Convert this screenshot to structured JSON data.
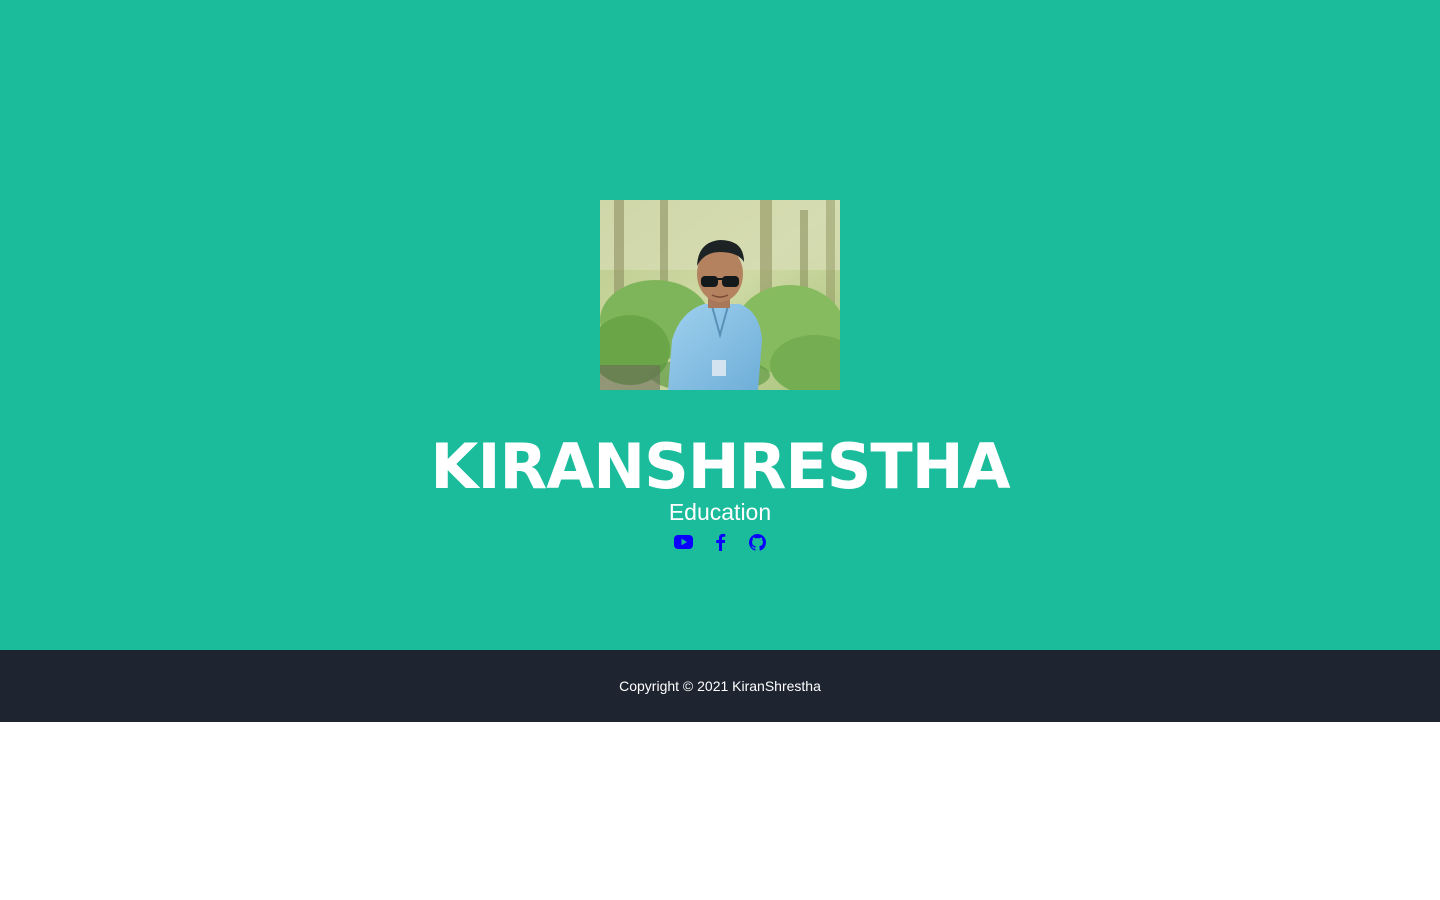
{
  "hero": {
    "name": "KIRANSHRESTHA",
    "subtitle": "Education",
    "photo_alt": "KiranShrestha",
    "background_color": "#1abc9c",
    "text_color": "#ffffff",
    "social_link_color": "#0a00ff",
    "socials": [
      {
        "name": "youtube",
        "icon": "youtube-icon"
      },
      {
        "name": "facebook",
        "icon": "facebook-icon"
      },
      {
        "name": "github",
        "icon": "github-icon"
      }
    ]
  },
  "footer": {
    "copyright": "Copyright © 2021 KiranShrestha",
    "background_color": "#1e2430"
  }
}
